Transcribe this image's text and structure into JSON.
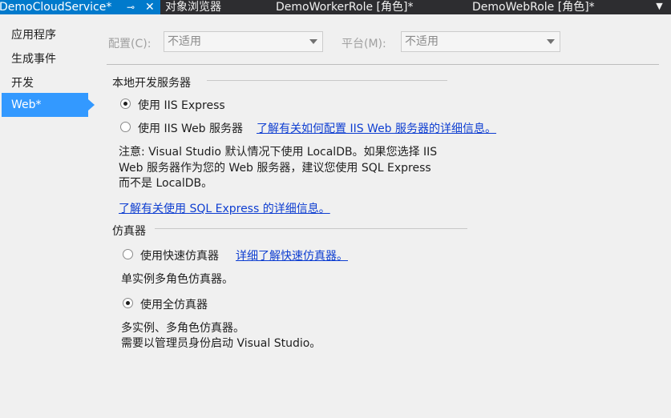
{
  "tabs": {
    "active": "DemoCloudService*",
    "others": [
      "对象浏览器",
      "DemoWorkerRole [角色]*",
      "DemoWebRole [角色]*"
    ]
  },
  "sidebar": {
    "items": [
      {
        "label": "应用程序"
      },
      {
        "label": "生成事件"
      },
      {
        "label": "开发"
      },
      {
        "label": "Web*"
      }
    ]
  },
  "config": {
    "config_label": "配置(C):",
    "config_value": "不适用",
    "platform_label": "平台(M):",
    "platform_value": "不适用"
  },
  "local_server": {
    "title": "本地开发服务器",
    "iis_express_label": "使用 IIS Express",
    "iis_web_label": "使用 IIS Web 服务器",
    "iis_web_link": "了解有关如何配置 IIS Web 服务器的详细信息。",
    "note_lines": [
      "注意: Visual Studio 默认情况下使用 LocalDB。如果您选择 IIS",
      "Web 服务器作为您的 Web 服务器，建议您使用 SQL Express",
      "而不是 LocalDB。"
    ],
    "sql_link": "了解有关使用 SQL Express 的详细信息。"
  },
  "emulator": {
    "title": "仿真器",
    "express_label": "使用快速仿真器",
    "express_link": "详细了解快速仿真器。",
    "express_desc": "单实例多角色仿真器。",
    "full_label": "使用全仿真器",
    "full_desc_lines": [
      "多实例、多角色仿真器。",
      "需要以管理员身份启动 Visual Studio。"
    ]
  },
  "colors": {
    "accent": "#007acc",
    "selection": "#3399ff",
    "link": "#0e3ed1",
    "tabbar": "#2d2d30"
  },
  "state": {
    "selected_sidebar": "Web*",
    "server_choice": "使用 IIS Express",
    "emulator_choice": "使用全仿真器"
  }
}
